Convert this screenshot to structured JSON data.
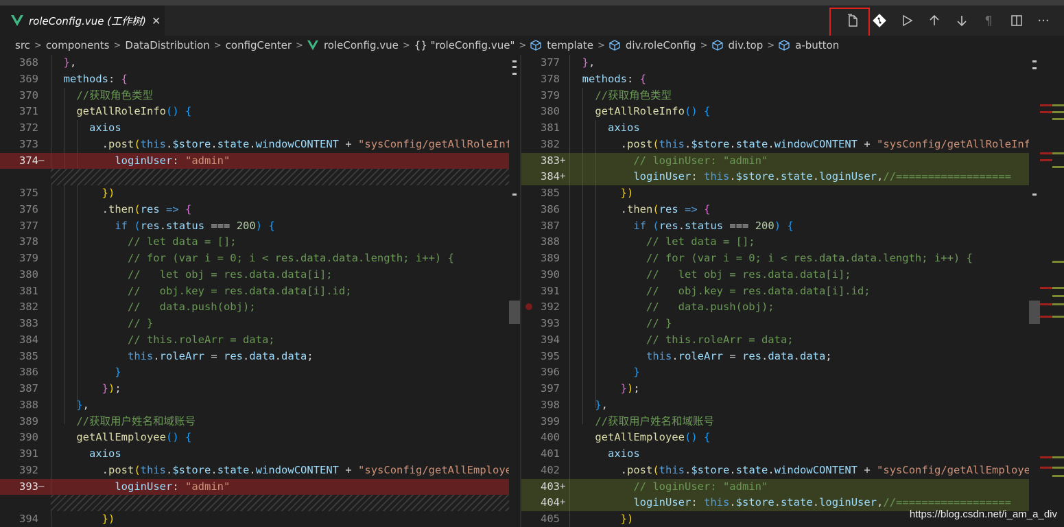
{
  "tab": {
    "title": "roleConfig.vue (工作树)",
    "close": "✕"
  },
  "breadcrumb": [
    "src",
    "components",
    "DataDistribution",
    "configCenter",
    "roleConfig.vue",
    "{} \"roleConfig.vue\"",
    "template",
    "div.roleConfig",
    "div.top",
    "a-button"
  ],
  "actions": [
    "open-file-icon",
    "git-compare-icon",
    "run-icon",
    "arrow-up-icon",
    "arrow-down-icon",
    "pilcrow-icon",
    "split-editor-icon",
    "more-icon"
  ],
  "colors": {
    "deleted": "#9b2323",
    "inserted": "#6e8228",
    "highlight": "#e0201c"
  },
  "watermark": "https://blog.csdn.net/i_am_a_div"
}
